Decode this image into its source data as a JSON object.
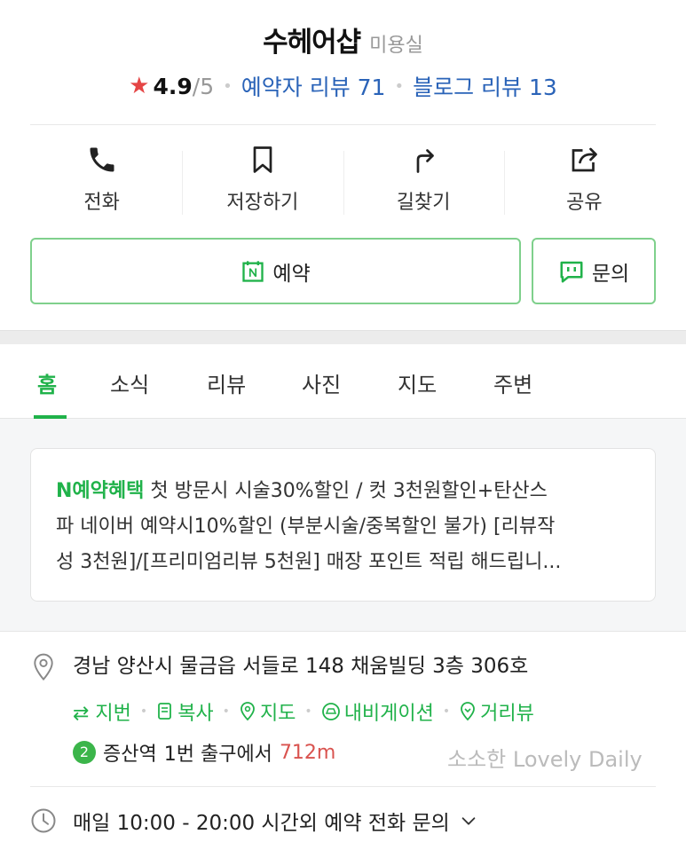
{
  "header": {
    "shop_name": "수헤어샵",
    "category": "미용실",
    "star": "★",
    "rating": "4.9",
    "rating_max": "/5",
    "booking_reviews": "예약자 리뷰 71",
    "blog_reviews": "블로그 리뷰 13"
  },
  "actions": [
    {
      "label": "전화",
      "icon": "phone-icon"
    },
    {
      "label": "저장하기",
      "icon": "bookmark-icon"
    },
    {
      "label": "길찾기",
      "icon": "directions-icon"
    },
    {
      "label": "공유",
      "icon": "share-icon"
    }
  ],
  "buttons": {
    "reserve": "예약",
    "inquiry": "문의"
  },
  "tabs": [
    "홈",
    "소식",
    "리뷰",
    "사진",
    "지도",
    "주변"
  ],
  "notice": {
    "tag": "N예약혜택",
    "line1": " 첫 방문시 시술30%할인 / 컷 3천원할인+탄산스",
    "line2": "파 네이버 예약시10%할인 (부분시술/중복할인 불가) [리뷰작",
    "line3": "성 3천원]/[프리미엄리뷰 5천원] 매장 포인트 적립 해드립니..."
  },
  "info": {
    "address": "경남 양산시 물금읍 서들로 148 채움빌딩 3층 306호",
    "links": [
      "⇄ 지번",
      "복사",
      "지도",
      "내비게이션",
      "거리뷰"
    ],
    "line_number": "2",
    "station": "증산역",
    "exit_text": "1번 출구에서",
    "distance": "712m",
    "watermark": "소소한 Lovely Daily",
    "hours": "매일 10:00 - 20:00 시간외 예약 전화 문의"
  },
  "colors": {
    "accent_green": "#20b24a",
    "link_blue": "#2a63b8",
    "star_red": "#e54545",
    "distance_red": "#d9534f"
  }
}
